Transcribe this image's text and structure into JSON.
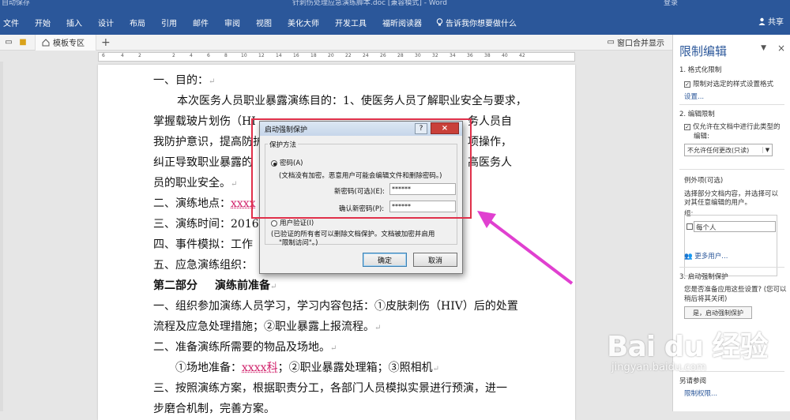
{
  "titlebar": {
    "quick_access": "自动保存",
    "title": "针刺伤处理应急演练脚本.doc [兼容模式] - Word",
    "sign_in": "登录"
  },
  "ribbon": {
    "tabs": [
      "文件",
      "开始",
      "插入",
      "设计",
      "布局",
      "引用",
      "邮件",
      "审阅",
      "视图",
      "美化大师",
      "开发工具",
      "福昕阅读器"
    ],
    "tell_me": "告诉我你想要做什么",
    "share": "共享"
  },
  "doctabs": {
    "template_tab": "模板专区",
    "plus": "+",
    "merge": "窗口合并显示"
  },
  "ruler": {
    "ticks": [
      "6",
      "4",
      "2",
      "",
      "2",
      "4",
      "6",
      "8",
      "10",
      "12",
      "14",
      "16",
      "18",
      "20",
      "22",
      "24",
      "26",
      "28",
      "30",
      "32",
      "34",
      "36",
      "38",
      "40",
      "42"
    ]
  },
  "doc": {
    "l1": "一、目的：",
    "l2": "本次医务人员职业暴露演练目的：1、使医务人员了解职业安全与要求，",
    "l3a": "掌握载玻片划伤（HI",
    "l3b": "务人员自",
    "l4a": "我防护意识，提高防护",
    "l4b": "项操作，",
    "l5a": "纠正导致职业暴露的",
    "l5b": "高医务人",
    "l6": "员的职业安全。",
    "l7a": "二、演练地点：",
    "l7b": "xxxx",
    "l8": "三、演练时间：2016",
    "l9": "四、事件模拟：工作",
    "l10": "五、应急演练组织：",
    "l11a": "第二部分",
    "l11b": "演练前准备",
    "l12": "一、组织参加演练人员学习，学习内容包括：①皮肤刺伤（HIV）后的处置",
    "l13": "流程及应急处理措施；②职业暴露上报流程。",
    "l14": "二、准备演练所需要的物品及场地。",
    "l15a": "①场地准备：",
    "l15b": "xxxx科",
    "l15c": "；②职业暴露处理箱；③照相机",
    "l16": "三、按照演练方案，根据职责分工，各部门人员模拟实景进行预演，进一",
    "l17": "步磨合机制，完善方案。",
    "pilcrow": "↵"
  },
  "dialog": {
    "title": "启动强制保护",
    "help": "?",
    "close": "×",
    "group": "保护方法",
    "password_label": "密码(A)",
    "password_note": "(文档没有加密。恶意用户可能会编辑文件和删除密码。)",
    "new_pw_label": "新密码(可选)(E):",
    "new_pw_value": "******",
    "confirm_pw_label": "确认新密码(P):",
    "confirm_pw_value": "******",
    "user_auth_label": "用户验证(I)",
    "user_auth_note1": "(已验证的所有者可以删除文档保护。文档被加密并启用",
    "user_auth_note2": "\"限制访问\"。)",
    "ok": "确定",
    "cancel": "取消"
  },
  "pane": {
    "title": "限制编辑",
    "dropdown": "▼",
    "close": "×",
    "s1": "1. 格式化限制",
    "s1_check": "限制对选定的样式设置格式",
    "s1_link": "设置...",
    "s2": "2. 编辑限制",
    "s2_check1": "仅允许在文档中进行此类型的",
    "s2_check2": "编辑:",
    "s2_select": "不允许任何更改(只读)",
    "s2_select_arrow": "▼",
    "exceptions": "例外项(可选)",
    "exc_desc1": "选择部分文档内容，并选择可以",
    "exc_desc2": "对其任意编辑的用户。",
    "group_label": "组:",
    "everyone": "每个人",
    "more_users": "更多用户...",
    "s3": "3. 启动强制保护",
    "s3_q1": "您是否准备应用这些设置? (您可以",
    "s3_q2": "稍后将其关闭)",
    "start_btn": "是，启动强制保护",
    "also_see": "另请参阅",
    "restrict_link": "限制权限..."
  },
  "watermark": {
    "brand": "Bai du 经验",
    "site": "jingyan.baidu.com"
  },
  "colors": {
    "ribbon": "#2b579a",
    "highlight": "#e0304a",
    "arrow": "#e040d0"
  }
}
